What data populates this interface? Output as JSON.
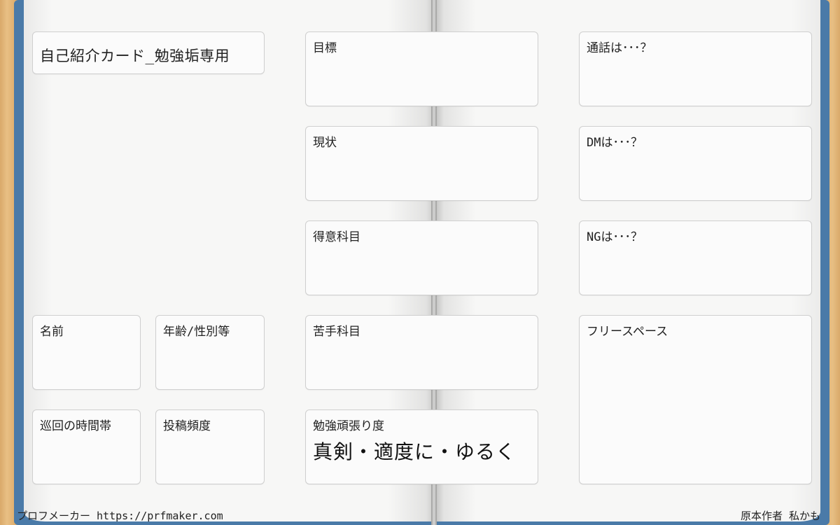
{
  "title": "自己紹介カード_勉強垢専用",
  "left_fields": {
    "name": "名前",
    "age_gender": "年齢/性別等",
    "patrol_time": "巡回の時間帯",
    "post_frequency": "投稿頻度"
  },
  "middle_fields": {
    "goal": "目標",
    "current_status": "現状",
    "strong_subject": "得意科目",
    "weak_subject": "苦手科目",
    "effort_label": "勉強頑張り度",
    "effort_options": "真剣・適度に・ゆるく"
  },
  "right_fields": {
    "call": "通話は･･･？",
    "dm": "DMは･･･？",
    "ng": "NGは･･･？",
    "free_space": "フリースペース"
  },
  "footer": {
    "maker": "プロフメーカー https://prfmaker.com",
    "author": "原本作者 私かも"
  },
  "colors": {
    "book_cover": "#4a7aa8",
    "desk": "#e0b070",
    "card_bg": "#fbfbfb",
    "card_border": "#cfcfcf"
  }
}
